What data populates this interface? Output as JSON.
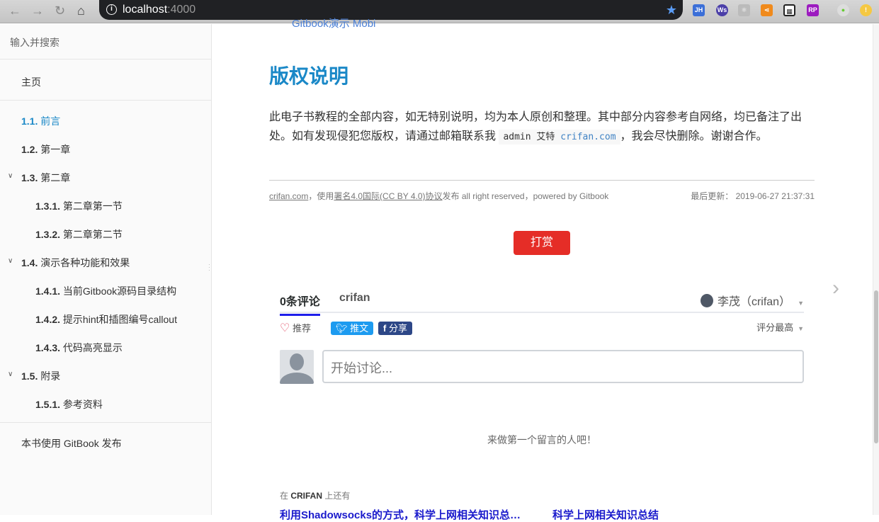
{
  "browser": {
    "url_host": "localhost",
    "url_port": ":4000",
    "extensions": [
      "JH",
      "Ws",
      "react",
      "share",
      "qr",
      "RP"
    ]
  },
  "sidebar": {
    "search_placeholder": "输入并搜索",
    "home": "主页",
    "items": [
      {
        "num": "1.1.",
        "label": "前言",
        "active": true
      },
      {
        "num": "1.2.",
        "label": "第一章"
      },
      {
        "num": "1.3.",
        "label": "第二章",
        "expanded": true
      },
      {
        "num": "1.3.1.",
        "label": "第二章第一节"
      },
      {
        "num": "1.3.2.",
        "label": "第二章第二节"
      },
      {
        "num": "1.4.",
        "label": "演示各种功能和效果",
        "expanded": true
      },
      {
        "num": "1.4.1.",
        "label": "当前Gitbook源码目录结构"
      },
      {
        "num": "1.4.2.",
        "label": "提示hint和插图编号callout"
      },
      {
        "num": "1.4.3.",
        "label": "代码高亮显示"
      },
      {
        "num": "1.5.",
        "label": "附录",
        "expanded": true
      },
      {
        "num": "1.5.1.",
        "label": "参考资料"
      }
    ],
    "publish": "本书使用 GitBook 发布"
  },
  "content": {
    "partial_link": "Gitbook演示 Mobi",
    "title": "版权说明",
    "para1": "此电子书教程的全部内容，如无特别说明，均为本人原创和整理。其中部分内容参考自网络，均已备注了出处。如有发现侵犯您版权，请通过邮箱联系我 ",
    "code_prefix": "admin 艾特 ",
    "code_link": "crifan.com",
    "para2": "，我会尽快删除。谢谢合作。",
    "footer_site": "crifan.com",
    "footer_use": "，使用",
    "footer_license": "署名4.0国际(CC BY 4.0)协议",
    "footer_rest": "发布 all right reserved，powered by Gitbook",
    "updated": "最后更新： 2019-06-27 21:37:31",
    "reward": "打赏"
  },
  "comments": {
    "tab_count": "0条评论",
    "tab_site": "crifan",
    "user": "李茂（crifan）",
    "recommend": "推荐",
    "tweet": "推文",
    "share": "分享",
    "sort": "评分最高",
    "placeholder": "开始讨论...",
    "empty": "来做第一个留言的人吧！",
    "also_prefix": "在 ",
    "also_site": "CRIFAN",
    "also_suffix": " 上还有",
    "related": [
      "利用Shadowsocks的方式，科学上网相关知识总…",
      "科学上网相关知识总结"
    ]
  }
}
